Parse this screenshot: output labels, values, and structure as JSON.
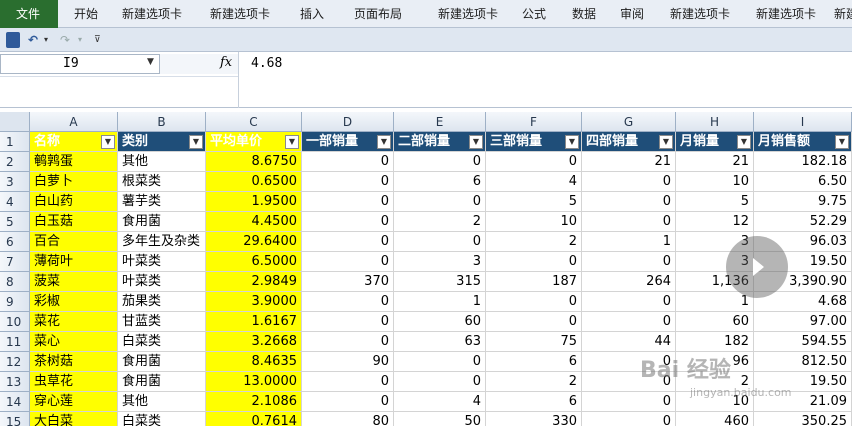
{
  "ribbon": {
    "tabs": [
      "文件",
      "开始",
      "新建选项卡",
      "新建选项卡",
      "插入",
      "页面布局",
      "新建选项卡",
      "公式",
      "数据",
      "审阅",
      "新建选项卡",
      "新建选项卡",
      "新建"
    ]
  },
  "formula_bar": {
    "name_box": "I9",
    "fx_label": "fx",
    "value": "4.68"
  },
  "columns": [
    "A",
    "B",
    "C",
    "D",
    "E",
    "F",
    "G",
    "H",
    "I"
  ],
  "headers": [
    "名称",
    "类别",
    "平均单价",
    "一部销量",
    "二部销量",
    "三部销量",
    "四部销量",
    "月销量",
    "月销售额"
  ],
  "rows": [
    {
      "n": "2",
      "c": [
        "鹌鹑蛋",
        "其他",
        "8.6750",
        "0",
        "0",
        "0",
        "21",
        "21",
        "182.18"
      ]
    },
    {
      "n": "3",
      "c": [
        "白萝卜",
        "根菜类",
        "0.6500",
        "0",
        "6",
        "4",
        "0",
        "10",
        "6.50"
      ]
    },
    {
      "n": "4",
      "c": [
        "白山药",
        "薯芋类",
        "1.9500",
        "0",
        "0",
        "5",
        "0",
        "5",
        "9.75"
      ]
    },
    {
      "n": "5",
      "c": [
        "白玉菇",
        "食用菌",
        "4.4500",
        "0",
        "2",
        "10",
        "0",
        "12",
        "52.29"
      ]
    },
    {
      "n": "6",
      "c": [
        "百合",
        "多年生及杂类",
        "29.6400",
        "0",
        "0",
        "2",
        "1",
        "3",
        "96.03"
      ]
    },
    {
      "n": "7",
      "c": [
        "薄荷叶",
        "叶菜类",
        "6.5000",
        "0",
        "3",
        "0",
        "0",
        "3",
        "19.50"
      ]
    },
    {
      "n": "8",
      "c": [
        "菠菜",
        "叶菜类",
        "2.9849",
        "370",
        "315",
        "187",
        "264",
        "1,136",
        "3,390.90"
      ]
    },
    {
      "n": "9",
      "c": [
        "彩椒",
        "茄果类",
        "3.9000",
        "0",
        "1",
        "0",
        "0",
        "1",
        "4.68"
      ]
    },
    {
      "n": "10",
      "c": [
        "菜花",
        "甘蓝类",
        "1.6167",
        "0",
        "60",
        "0",
        "0",
        "60",
        "97.00"
      ]
    },
    {
      "n": "11",
      "c": [
        "菜心",
        "白菜类",
        "3.2668",
        "0",
        "63",
        "75",
        "44",
        "182",
        "594.55"
      ]
    },
    {
      "n": "12",
      "c": [
        "茶树菇",
        "食用菌",
        "8.4635",
        "90",
        "0",
        "6",
        "0",
        "96",
        "812.50"
      ]
    },
    {
      "n": "13",
      "c": [
        "虫草花",
        "食用菌",
        "13.0000",
        "0",
        "0",
        "2",
        "0",
        "2",
        "19.50"
      ]
    },
    {
      "n": "14",
      "c": [
        "穿心莲",
        "其他",
        "2.1086",
        "0",
        "4",
        "6",
        "0",
        "10",
        "21.09"
      ]
    },
    {
      "n": "15",
      "c": [
        "大白菜",
        "白菜类",
        "0.7614",
        "80",
        "50",
        "330",
        "0",
        "460",
        "350.25"
      ]
    }
  ],
  "watermark": {
    "line1": "Bai 经验",
    "line2": "jingyan.baidu.com"
  },
  "colors": {
    "header_blue": "#1f4e79",
    "highlight_yellow": "#ffff00",
    "file_tab": "#2a6e2f"
  }
}
